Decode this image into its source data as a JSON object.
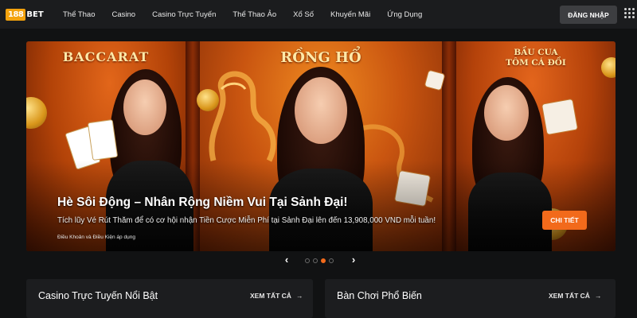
{
  "brand": {
    "logo_num": "188",
    "logo_text": "BET"
  },
  "nav": {
    "items": [
      {
        "label": "Thể Thao"
      },
      {
        "label": "Casino"
      },
      {
        "label": "Casino Trực Tuyến"
      },
      {
        "label": "Thể Thao Ảo"
      },
      {
        "label": "Xổ Số"
      },
      {
        "label": "Khuyến Mãi"
      },
      {
        "label": "Ứng Dụng"
      }
    ],
    "login_label": "ĐĂNG NHẬP",
    "menu_icon": "grid-dots-icon"
  },
  "banner": {
    "panels": [
      {
        "title": "BACCARAT"
      },
      {
        "title": "RỒNG HỔ"
      },
      {
        "title_line1": "BẦU CUA",
        "title_line2": "TÔM CÁ ĐỒI"
      }
    ],
    "headline": "Hè Sôi Động – Nhân Rộng Niềm Vui Tại Sảnh Đại!",
    "description": "Tích lũy Vé Rút Thăm để có cơ hội nhận Tiền Cược Miễn Phí tại Sảnh Đại lên đến 13,908,000 VND mỗi tuần!",
    "terms": "Điều Khoản và Điều Kiện áp dụng",
    "cta_label": "CHI TIẾT"
  },
  "carousel": {
    "prev_icon": "‹",
    "next_icon": "›",
    "slide_count": 4,
    "active_index": 2
  },
  "sections": [
    {
      "title": "Casino Trực Tuyến Nổi Bật",
      "link_label": "XEM TẤT CẢ",
      "link_icon": "→"
    },
    {
      "title": "Bàn Chơi Phổ Biến",
      "link_label": "XEM TẤT CẢ",
      "link_icon": "→"
    }
  ],
  "colors": {
    "accent": "#f26a1b",
    "background": "#111213",
    "nav": "#1b1c1e",
    "logo": "#f3a20d"
  }
}
